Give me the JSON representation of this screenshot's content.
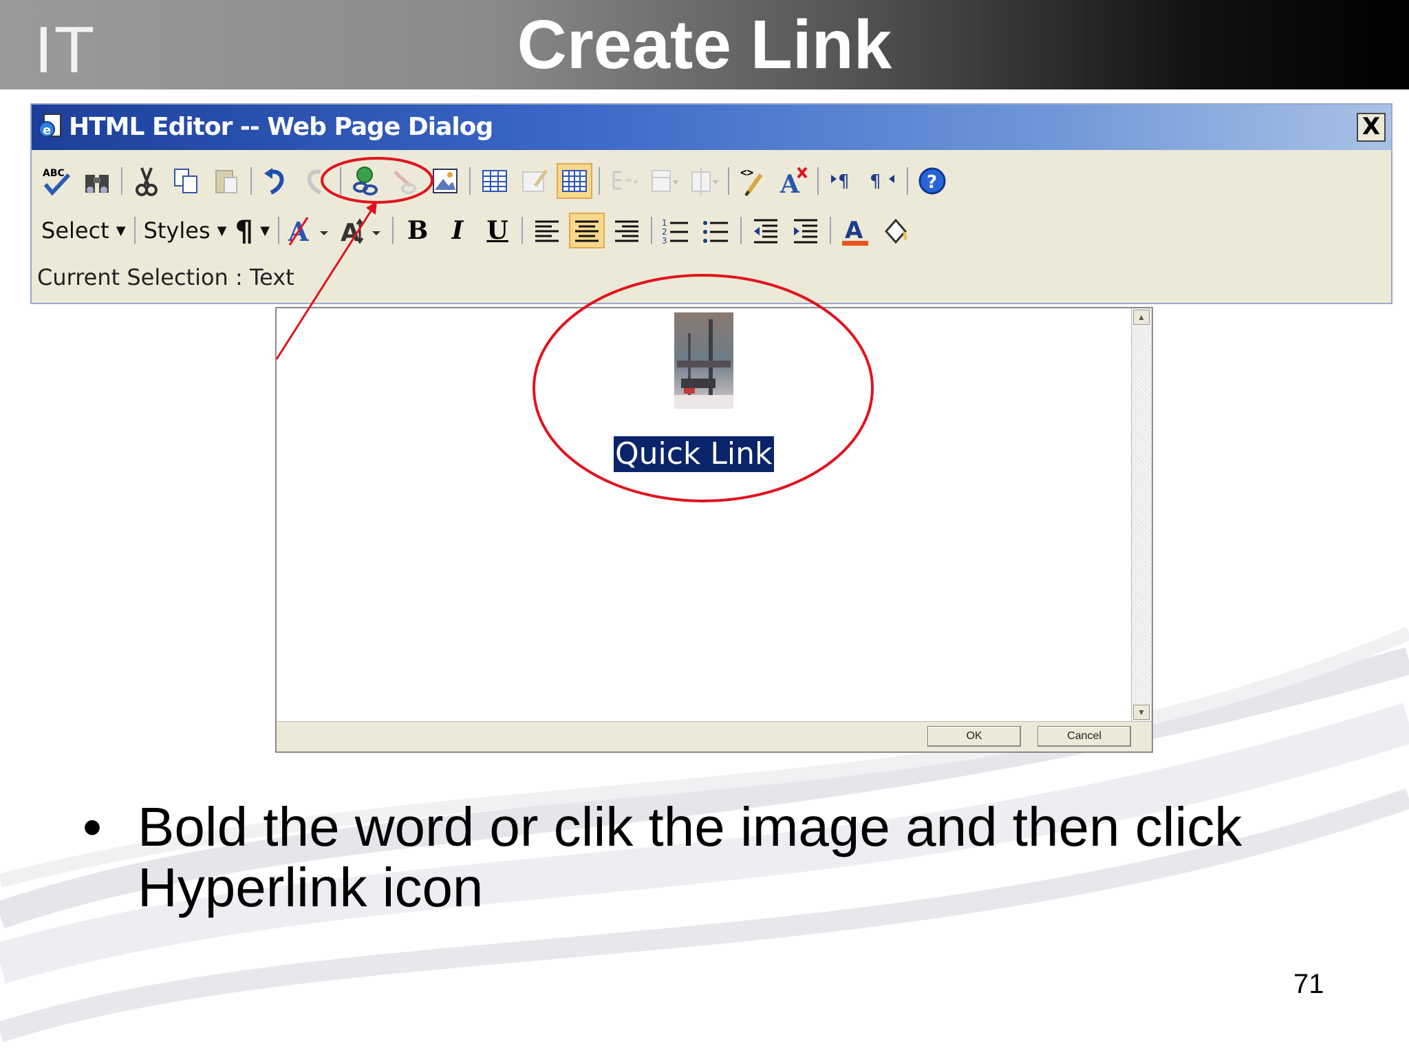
{
  "header": {
    "logo_text": "IT",
    "title": "Create Link"
  },
  "dialog": {
    "title": "HTML Editor -- Web Page Dialog",
    "close_label": "X",
    "toolbar_row1": [
      "spellcheck-icon",
      "find-icon",
      "cut-icon",
      "copy-icon",
      "paste-icon",
      "undo-icon",
      "redo-icon",
      "hyperlink-icon",
      "unlink-icon",
      "insert-image-icon",
      "insert-table-icon",
      "edit-table-icon",
      "table-props-icon",
      "insert-row-icon",
      "insert-column-icon",
      "merge-cells-icon",
      "source-code-icon",
      "clear-format-icon",
      "ltr-icon",
      "rtl-icon",
      "help-icon"
    ],
    "toolbar_row2": {
      "select_label": "Select",
      "styles_label": "Styles",
      "paragraph_label": "¶",
      "bold_label": "B",
      "italic_label": "I",
      "underline_label": "U"
    },
    "current_selection": "Current Selection : Text"
  },
  "editor": {
    "link_text": "Quick Link",
    "ok_label": "OK",
    "cancel_label": "Cancel"
  },
  "colors": {
    "selection_bg": "#0a246a",
    "annotation": "#e0141e",
    "titlebar": "#3c68c8"
  },
  "bullet": {
    "text": "Bold the word or clik the image and then click Hyperlink icon"
  },
  "page_number": "71"
}
